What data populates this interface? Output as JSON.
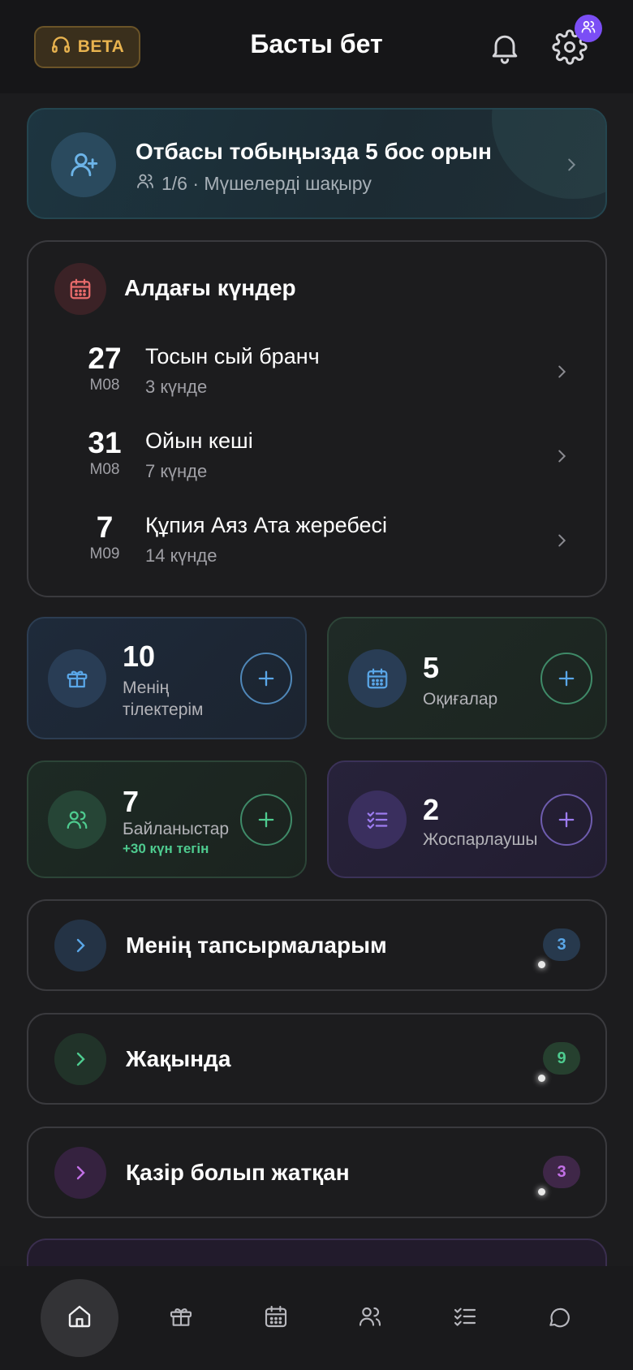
{
  "header": {
    "beta_label": "BETA",
    "title": "Басты бет",
    "icons": [
      "headset-icon",
      "bell-icon",
      "gear-icon",
      "users-icon"
    ]
  },
  "invite": {
    "title": "Отбасы тобыңызда 5 бос орын",
    "subtitle": "1/6 · Мүшелерді шақыру"
  },
  "upcoming": {
    "title": "Алдағы күндер",
    "events": [
      {
        "day": "27",
        "month": "M08",
        "name": "Тосын сый бранч",
        "when": "3 күнде"
      },
      {
        "day": "31",
        "month": "M08",
        "name": "Ойын кеші",
        "when": "7 күнде"
      },
      {
        "day": "7",
        "month": "M09",
        "name": "Құпия Аяз Ата жеребесі",
        "when": "14 күнде"
      }
    ]
  },
  "tiles": {
    "wishes": {
      "count": "10",
      "label": "Менің тілектерім"
    },
    "events": {
      "count": "5",
      "label": "Оқиғалар"
    },
    "contacts": {
      "count": "7",
      "label": "Байланыстар",
      "promo": "+30 күн тегін"
    },
    "planner": {
      "count": "2",
      "label": "Жоспарлаушы"
    }
  },
  "rows": [
    {
      "label": "Менің тапсырмаларым",
      "count": "3"
    },
    {
      "label": "Жақында",
      "count": "9"
    },
    {
      "label": "Қазір болып жатқан",
      "count": "3"
    }
  ],
  "colors": {
    "accent_blue": "#5aa7e8",
    "accent_green": "#4ecb8f",
    "accent_purple": "#9d7cf0",
    "accent_pink": "#c270e6",
    "beta_gold": "#e8b34f"
  },
  "bottom_nav": [
    "home-icon",
    "gift-icon",
    "calendar-icon",
    "users-icon",
    "checklist-icon",
    "chat-icon"
  ]
}
